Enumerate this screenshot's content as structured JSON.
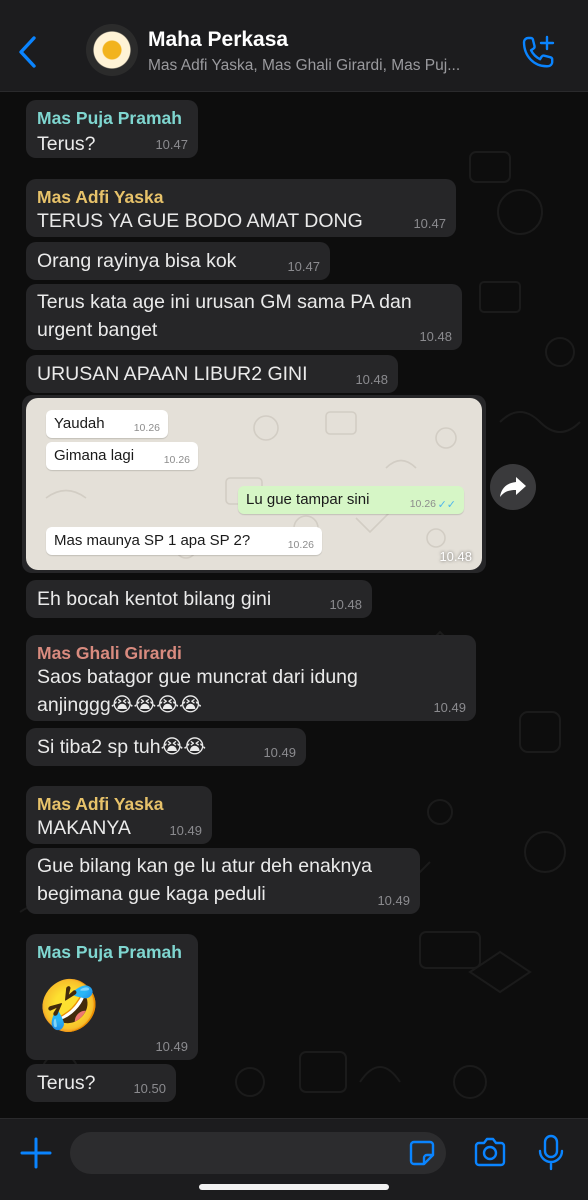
{
  "header": {
    "title": "Maha Perkasa",
    "subtitle": "Mas Adfi Yaska, Mas Ghali Girardi, Mas Puj..."
  },
  "colors": {
    "accent": "#0a84ff",
    "sender_puja": "#7fd6d0",
    "sender_adfi": "#e7c26a",
    "sender_ghali": "#d98b7f"
  },
  "messages": {
    "m1": {
      "sender": "Mas Puja Pramah",
      "text": "Terus?",
      "time": "10.47"
    },
    "m2": {
      "sender": "Mas Adfi Yaska",
      "text": "TERUS YA GUE BODO AMAT DONG",
      "time": "10.47"
    },
    "m3": {
      "text": "Orang rayinya bisa kok",
      "time": "10.47"
    },
    "m4": {
      "line1": "Terus kata age ini urusan GM sama PA dan",
      "line2": "urgent banget",
      "time": "10.48"
    },
    "m5": {
      "text": "URUSAN APAAN LIBUR2 GINI",
      "time": "10.48"
    },
    "m6": {
      "time": "10.48",
      "shot": {
        "b1": {
          "text": "Yaudah",
          "time": "10.26"
        },
        "b2": {
          "text": "Gimana lagi",
          "time": "10.26"
        },
        "b3": {
          "text": "Lu gue tampar sini",
          "time": "10.26",
          "ticks": "✓✓"
        },
        "b4": {
          "text": "Mas maunya SP 1 apa SP 2?",
          "time": "10.26"
        }
      }
    },
    "m7": {
      "text": "Eh bocah kentot bilang gini",
      "time": "10.48"
    },
    "m8": {
      "sender": "Mas Ghali Girardi",
      "line1": "Saos batagor gue muncrat dari idung",
      "line2": "anjinggg😭😭😭😭",
      "time": "10.49"
    },
    "m9": {
      "text": "Si tiba2 sp tuh😭😭",
      "time": "10.49"
    },
    "m10": {
      "sender": "Mas Adfi Yaska",
      "text": "MAKANYA",
      "time": "10.49"
    },
    "m11": {
      "line1": "Gue bilang kan ge lu atur deh enaknya",
      "line2": "begimana gue kaga peduli",
      "time": "10.49"
    },
    "m12": {
      "sender": "Mas Puja Pramah",
      "emoji": "🤣",
      "time": "10.49"
    },
    "m13": {
      "text": "Terus?",
      "time": "10.50"
    }
  },
  "icons": {
    "back": "chevron-left-icon",
    "call": "phone-plus-icon",
    "forward": "forward-arrow-icon",
    "attach": "plus-icon",
    "sticker": "sticker-icon",
    "camera": "camera-icon",
    "mic": "microphone-icon"
  }
}
